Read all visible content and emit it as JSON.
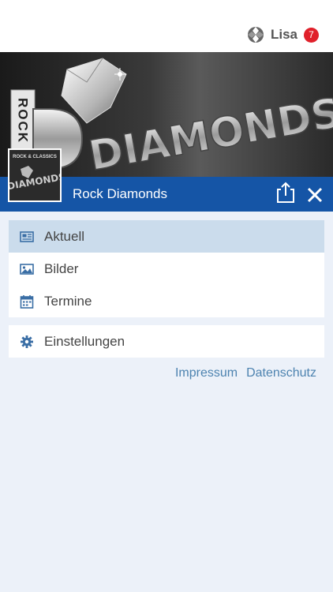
{
  "header": {
    "user_name": "Lisa",
    "notification_count": "7",
    "badge_color": "#e0202a"
  },
  "banner": {
    "rock_text": "ROCK",
    "diamonds_text": "DIAMONDS",
    "thumb_top": "ROCK & CLASSICS",
    "thumb_logo": "DIAMONDS"
  },
  "titlebar": {
    "title": "Rock Diamonds",
    "color": "#1555a6",
    "share_icon": "share-icon",
    "close_icon": "close-icon"
  },
  "menu": {
    "items": [
      {
        "label": "Aktuell",
        "icon": "newspaper-icon",
        "active": true
      },
      {
        "label": "Bilder",
        "icon": "image-icon",
        "active": false
      },
      {
        "label": "Termine",
        "icon": "calendar-icon",
        "active": false
      }
    ],
    "settings": {
      "label": "Einstellungen",
      "icon": "gear-icon"
    }
  },
  "footer": {
    "impressum": "Impressum",
    "datenschutz": "Datenschutz"
  }
}
